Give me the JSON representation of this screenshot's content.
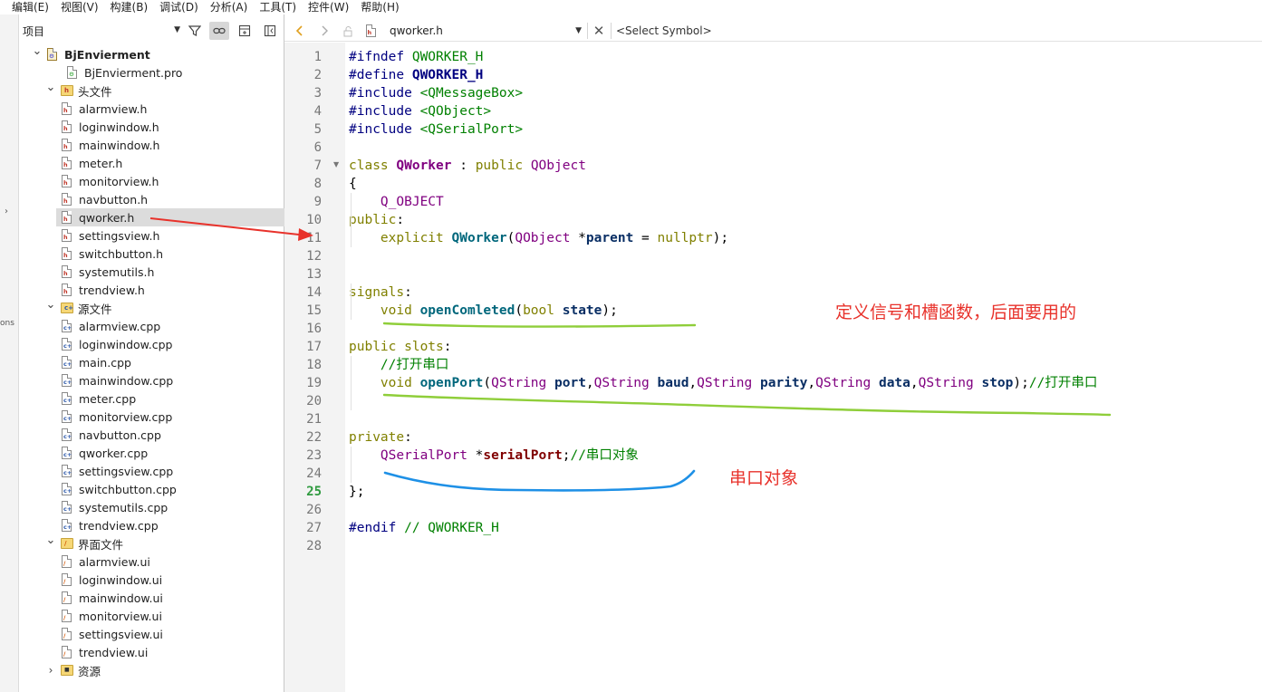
{
  "menubar": {
    "items": [
      "编辑(E)",
      "视图(V)",
      "构建(B)",
      "调试(D)",
      "分析(A)",
      "工具(T)",
      "控件(W)",
      "帮助(H)"
    ]
  },
  "left_strip": {
    "text": "ons"
  },
  "project_panel": {
    "selector_label": "项目",
    "toolbar_icons": [
      "filter-icon",
      "link-icon",
      "split-add-icon",
      "close-sidebar-icon"
    ],
    "tree": [
      {
        "label": "BjEnvierment",
        "type": "project",
        "depth": 0,
        "expanded": true,
        "bold": true
      },
      {
        "label": "BjEnvierment.pro",
        "type": "pro",
        "depth": 1
      },
      {
        "label": "头文件",
        "type": "folder-h",
        "depth": 1,
        "expanded": true
      },
      {
        "label": "alarmview.h",
        "type": "h",
        "depth": 2
      },
      {
        "label": "loginwindow.h",
        "type": "h",
        "depth": 2
      },
      {
        "label": "mainwindow.h",
        "type": "h",
        "depth": 2
      },
      {
        "label": "meter.h",
        "type": "h",
        "depth": 2
      },
      {
        "label": "monitorview.h",
        "type": "h",
        "depth": 2
      },
      {
        "label": "navbutton.h",
        "type": "h",
        "depth": 2
      },
      {
        "label": "qworker.h",
        "type": "h",
        "depth": 2,
        "selected": true
      },
      {
        "label": "settingsview.h",
        "type": "h",
        "depth": 2
      },
      {
        "label": "switchbutton.h",
        "type": "h",
        "depth": 2
      },
      {
        "label": "systemutils.h",
        "type": "h",
        "depth": 2
      },
      {
        "label": "trendview.h",
        "type": "h",
        "depth": 2
      },
      {
        "label": "源文件",
        "type": "folder-cpp",
        "depth": 1,
        "expanded": true
      },
      {
        "label": "alarmview.cpp",
        "type": "cpp",
        "depth": 2
      },
      {
        "label": "loginwindow.cpp",
        "type": "cpp",
        "depth": 2
      },
      {
        "label": "main.cpp",
        "type": "cpp",
        "depth": 2
      },
      {
        "label": "mainwindow.cpp",
        "type": "cpp",
        "depth": 2
      },
      {
        "label": "meter.cpp",
        "type": "cpp",
        "depth": 2
      },
      {
        "label": "monitorview.cpp",
        "type": "cpp",
        "depth": 2
      },
      {
        "label": "navbutton.cpp",
        "type": "cpp",
        "depth": 2
      },
      {
        "label": "qworker.cpp",
        "type": "cpp",
        "depth": 2
      },
      {
        "label": "settingsview.cpp",
        "type": "cpp",
        "depth": 2
      },
      {
        "label": "switchbutton.cpp",
        "type": "cpp",
        "depth": 2
      },
      {
        "label": "systemutils.cpp",
        "type": "cpp",
        "depth": 2
      },
      {
        "label": "trendview.cpp",
        "type": "cpp",
        "depth": 2
      },
      {
        "label": "界面文件",
        "type": "folder-ui",
        "depth": 1,
        "expanded": true
      },
      {
        "label": "alarmview.ui",
        "type": "ui",
        "depth": 2
      },
      {
        "label": "loginwindow.ui",
        "type": "ui",
        "depth": 2
      },
      {
        "label": "mainwindow.ui",
        "type": "ui",
        "depth": 2
      },
      {
        "label": "monitorview.ui",
        "type": "ui",
        "depth": 2
      },
      {
        "label": "settingsview.ui",
        "type": "ui",
        "depth": 2
      },
      {
        "label": "trendview.ui",
        "type": "ui",
        "depth": 2
      },
      {
        "label": "资源",
        "type": "folder-res",
        "depth": 1,
        "expanded": false
      }
    ]
  },
  "editor": {
    "file_name": "qworker.h",
    "symbol_placeholder": "<Select Symbol>",
    "current_line": 25,
    "lines": [
      [
        [
          "pp",
          "#ifndef "
        ],
        [
          "macro",
          ""
        ],
        [
          "str",
          "QWORKER_H"
        ]
      ],
      [
        [
          "pp",
          "#define "
        ],
        [
          "macro",
          "QWORKER_H"
        ]
      ],
      [
        [
          "pp",
          "#include "
        ],
        [
          "str",
          "<QMessageBox>"
        ]
      ],
      [
        [
          "pp",
          "#include "
        ],
        [
          "str",
          "<QObject>"
        ]
      ],
      [
        [
          "pp",
          "#include "
        ],
        [
          "str",
          "<QSerialPort>"
        ]
      ],
      [],
      [
        [
          "kw",
          "class "
        ],
        [
          "cls",
          "QWorker"
        ],
        [
          "plain",
          " : "
        ],
        [
          "kw",
          "public "
        ],
        [
          "typ",
          "QObject"
        ]
      ],
      [
        [
          "plain",
          "{"
        ]
      ],
      [
        [
          "plain",
          "    "
        ],
        [
          "typ",
          "Q_OBJECT"
        ]
      ],
      [
        [
          "kw",
          "public"
        ],
        [
          "plain",
          ":"
        ]
      ],
      [
        [
          "plain",
          "    "
        ],
        [
          "kw",
          "explicit "
        ],
        [
          "fn",
          "QWorker"
        ],
        [
          "plain",
          "("
        ],
        [
          "typ",
          "QObject"
        ],
        [
          "plain",
          " *"
        ],
        [
          "param",
          "parent"
        ],
        [
          "plain",
          " = "
        ],
        [
          "kw",
          "nullptr"
        ],
        [
          "plain",
          ");"
        ]
      ],
      [],
      [],
      [
        [
          "kw",
          "signals"
        ],
        [
          "plain",
          ":"
        ]
      ],
      [
        [
          "plain",
          "    "
        ],
        [
          "kw",
          "void "
        ],
        [
          "fn",
          "openComleted"
        ],
        [
          "plain",
          "("
        ],
        [
          "kw",
          "bool "
        ],
        [
          "param",
          "state"
        ],
        [
          "plain",
          ");"
        ]
      ],
      [],
      [
        [
          "kw",
          "public slots"
        ],
        [
          "plain",
          ":"
        ]
      ],
      [
        [
          "plain",
          "    "
        ],
        [
          "cm",
          "//打开串口"
        ]
      ],
      [
        [
          "plain",
          "    "
        ],
        [
          "kw",
          "void "
        ],
        [
          "fn",
          "openPort"
        ],
        [
          "plain",
          "("
        ],
        [
          "typ",
          "QString"
        ],
        [
          "plain",
          " "
        ],
        [
          "param",
          "port"
        ],
        [
          "plain",
          ","
        ],
        [
          "typ",
          "QString"
        ],
        [
          "plain",
          " "
        ],
        [
          "param",
          "baud"
        ],
        [
          "plain",
          ","
        ],
        [
          "typ",
          "QString"
        ],
        [
          "plain",
          " "
        ],
        [
          "param",
          "parity"
        ],
        [
          "plain",
          ","
        ],
        [
          "typ",
          "QString"
        ],
        [
          "plain",
          " "
        ],
        [
          "param",
          "data"
        ],
        [
          "plain",
          ","
        ],
        [
          "typ",
          "QString"
        ],
        [
          "plain",
          " "
        ],
        [
          "param",
          "stop"
        ],
        [
          "plain",
          ");"
        ],
        [
          "cm",
          "//打开串口"
        ]
      ],
      [],
      [],
      [
        [
          "kw",
          "private"
        ],
        [
          "plain",
          ":"
        ]
      ],
      [
        [
          "plain",
          "    "
        ],
        [
          "typ",
          "QSerialPort"
        ],
        [
          "plain",
          " *"
        ],
        [
          "member",
          "serialPort"
        ],
        [
          "plain",
          ";"
        ],
        [
          "cm",
          "//串口对象"
        ]
      ],
      [],
      [
        [
          "plain",
          "};"
        ]
      ],
      [],
      [
        [
          "pp",
          "#endif "
        ],
        [
          "cm",
          "// QWORKER_H"
        ]
      ],
      []
    ]
  },
  "annotations": {
    "signal_note": "定义信号和槽函数，后面要用的",
    "serial_note": "串口对象"
  },
  "colors": {
    "arrow": "#e8322b",
    "underline_green": "#8fce3a",
    "underline_blue": "#1e90e6",
    "annotation_text": "#e8322b"
  }
}
